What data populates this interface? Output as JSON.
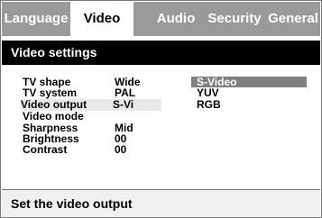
{
  "tabs": [
    {
      "label": "Language"
    },
    {
      "label": "Video"
    },
    {
      "label": "Audio"
    },
    {
      "label": "Security"
    },
    {
      "label": "General"
    }
  ],
  "active_tab": "Video",
  "panel_title": "Video settings",
  "settings": [
    {
      "label": "TV shape",
      "value": "Wide"
    },
    {
      "label": "TV system",
      "value": "PAL"
    },
    {
      "label": "Video output",
      "value": "S-Vi"
    },
    {
      "label": "Video mode",
      "value": ""
    },
    {
      "label": "Sharpness",
      "value": "Mid"
    },
    {
      "label": "Brightness",
      "value": "00"
    },
    {
      "label": "Contrast",
      "value": "00"
    }
  ],
  "options": [
    {
      "label": "S-Video"
    },
    {
      "label": "YUV"
    },
    {
      "label": "RGB"
    }
  ],
  "highlighted_option": "S-Video",
  "status_text": "Set the video output",
  "colors": {
    "tab_bar": "#9a9a9a",
    "header_bg": "#000000",
    "highlight": "#808080"
  }
}
